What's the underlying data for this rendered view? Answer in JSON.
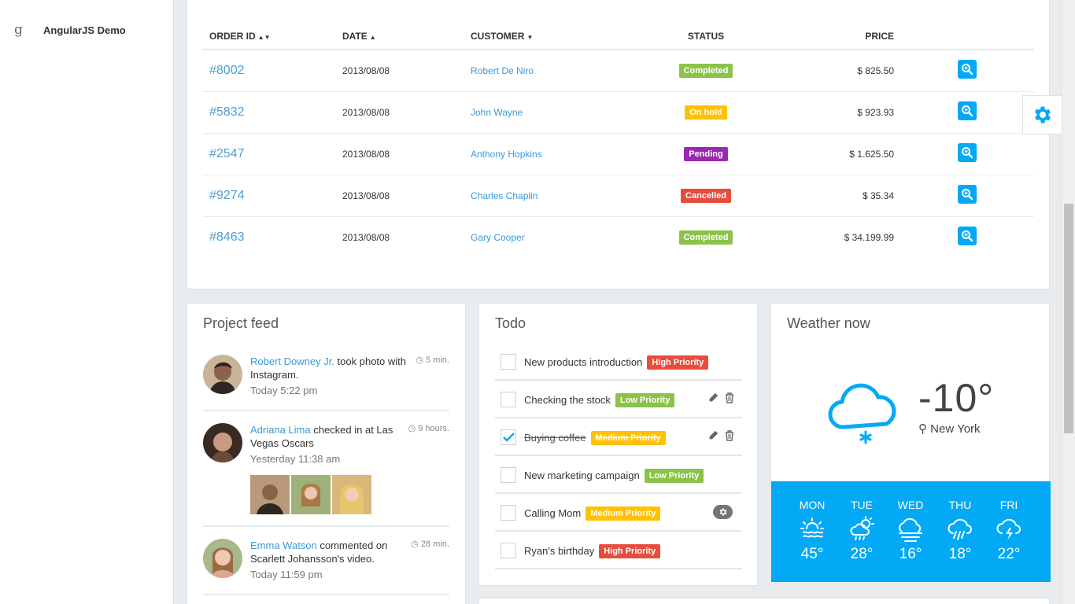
{
  "sidebar": {
    "cut_label": "...",
    "menu_item": {
      "icon": "google-icon",
      "glyph": "g",
      "label": "AngularJS Demo"
    }
  },
  "orders": {
    "columns": {
      "order_id": "ORDER ID",
      "date": "DATE",
      "customer": "CUSTOMER",
      "status": "STATUS",
      "price": "PRICE"
    },
    "rows": [
      {
        "id": "#8002",
        "date": "2013/08/08",
        "customer": "Robert De Niro",
        "status": "Completed",
        "status_type": "completed",
        "price": "$ 825.50"
      },
      {
        "id": "#5832",
        "date": "2013/08/08",
        "customer": "John Wayne",
        "status": "On hold",
        "status_type": "onhold",
        "price": "$ 923.93"
      },
      {
        "id": "#2547",
        "date": "2013/08/08",
        "customer": "Anthony Hopkins",
        "status": "Pending",
        "status_type": "pending",
        "price": "$ 1.625.50"
      },
      {
        "id": "#9274",
        "date": "2013/08/08",
        "customer": "Charles Chaplin",
        "status": "Cancelled",
        "status_type": "cancelled",
        "price": "$ 35.34"
      },
      {
        "id": "#8463",
        "date": "2013/08/08",
        "customer": "Gary Cooper",
        "status": "Completed",
        "status_type": "completed",
        "price": "$ 34.199.99"
      }
    ]
  },
  "feed": {
    "title": "Project feed",
    "items": [
      {
        "who": "Robert Downey Jr.",
        "action": " took photo with Instagram.",
        "ago": "5 min.",
        "when": "Today 5:22 pm"
      },
      {
        "who": "Adriana Lima",
        "action": " checked in at Las Vegas Oscars",
        "ago": "9 hours.",
        "when": "Yesterday 11:38 am"
      },
      {
        "who": "Emma Watson",
        "action": " commented on Scarlett Johansson's video.",
        "ago": "28 min.",
        "when": "Today 11:59 pm"
      }
    ]
  },
  "todo": {
    "title": "Todo",
    "items": [
      {
        "text": "New products introduction",
        "priority": "High Priority",
        "checked": false
      },
      {
        "text": "Checking the stock",
        "priority": "Low Priority",
        "checked": false
      },
      {
        "text": "Buying coffee",
        "priority": "Medium Priority",
        "checked": true
      },
      {
        "text": "New marketing campaign",
        "priority": "Low Priority",
        "checked": false
      },
      {
        "text": "Calling Mom",
        "priority": "Medium Priority",
        "checked": false
      },
      {
        "text": "Ryan's birthday",
        "priority": "High Priority",
        "checked": false
      }
    ]
  },
  "weather": {
    "title": "Weather now",
    "temp": "-10°",
    "city": "New York",
    "forecast": [
      {
        "day": "MON",
        "temp": "45°",
        "icon": "sun-haze-icon"
      },
      {
        "day": "TUE",
        "temp": "28°",
        "icon": "sun-cloud-rain-icon"
      },
      {
        "day": "WED",
        "temp": "16°",
        "icon": "cloud-fog-icon"
      },
      {
        "day": "THU",
        "temp": "18°",
        "icon": "cloud-rain-icon"
      },
      {
        "day": "FRI",
        "temp": "22°",
        "icon": "cloud-lightning-icon"
      }
    ]
  },
  "colors": {
    "accent": "#03a9f4",
    "link": "#3a9ad9",
    "completed": "#8bc34a",
    "onhold": "#ffc107",
    "pending": "#9c27b0",
    "cancelled": "#e74c3c"
  }
}
